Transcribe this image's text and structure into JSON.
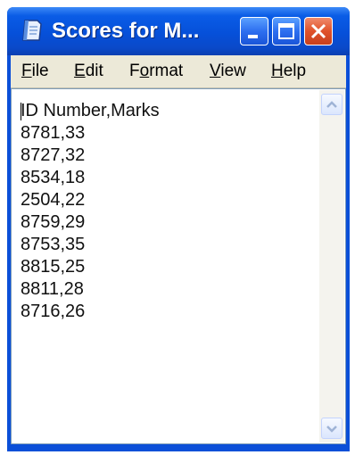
{
  "window": {
    "title": "Scores for M..."
  },
  "menu": [
    {
      "mnemonic": "F",
      "rest": "ile"
    },
    {
      "mnemonic": "E",
      "rest": "dit"
    },
    {
      "pre": "F",
      "mnemonic": "o",
      "rest": "rmat"
    },
    {
      "mnemonic": "V",
      "rest": "iew"
    },
    {
      "mnemonic": "H",
      "rest": "elp"
    }
  ],
  "document": {
    "lines": [
      "ID Number,Marks",
      "8781,33",
      "8727,32",
      "8534,18",
      "2504,22",
      "8759,29",
      "8753,35",
      "8815,25",
      "8811,28",
      "8716,26"
    ]
  },
  "icons": {
    "app": "notepad-icon",
    "minimize": "minimize-icon",
    "maximize": "maximize-icon",
    "close": "close-icon",
    "scroll_up": "scroll-up-arrow-icon",
    "scroll_down": "scroll-down-arrow-icon"
  }
}
